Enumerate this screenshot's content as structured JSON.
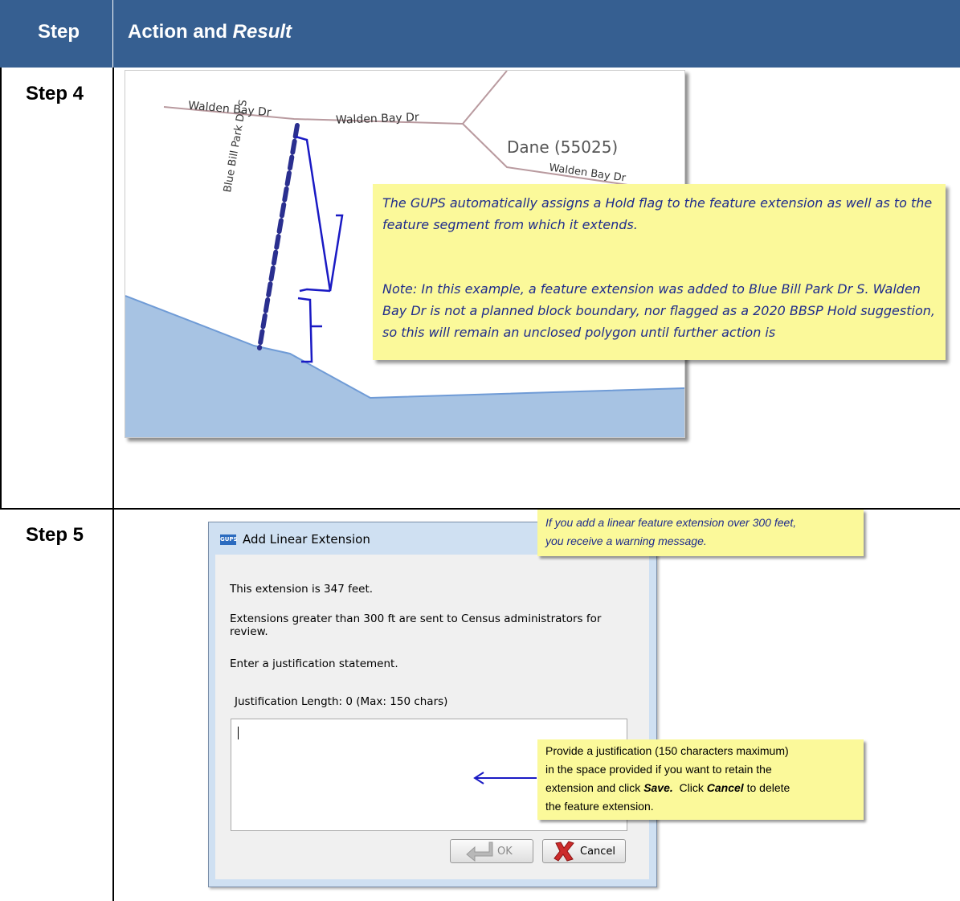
{
  "table": {
    "header": {
      "step": "Step",
      "action": "Action and ",
      "action_italic": "Result"
    },
    "rows": [
      {
        "label": "Step 4"
      },
      {
        "label": "Step 5"
      }
    ]
  },
  "map": {
    "labels": {
      "road_left": "Walden Bay Dr",
      "road_mid": "Walden Bay Dr",
      "road_right": "Walden Bay Dr",
      "county": "Dane (55025)",
      "vertical_road": "Blue Bill Park Dr S"
    },
    "colors": {
      "water": "#a7c3e3",
      "road": "#b99a9f",
      "extension": "#2a2f8f",
      "bracket": "#1a1ac4"
    },
    "callout": {
      "para1": "The GUPS automatically assigns a Hold flag to the feature extension as well as to the feature segment from which it extends.",
      "para2": "Note: In this example, a feature extension was added to Blue Bill Park Dr S. Walden Bay Dr is not a planned block boundary, nor flagged as a 2020 BBSP Hold suggestion, so this will remain an unclosed polygon until further action is"
    }
  },
  "dialog": {
    "icon_text": "GUPS",
    "title": "Add Linear Extension",
    "line1": "This extension is 347 feet.",
    "line2a": "Extensions greater than 300 ft are sent to Census administrators for",
    "line2b": "review.",
    "line3": "Enter a justification statement.",
    "length_label": "Justification Length: 0 (Max: 150 chars)",
    "justification_value": "",
    "ok_label": "OK",
    "cancel_label": "Cancel"
  },
  "callouts": {
    "top_line1": "If you add a linear feature extension over 300 feet,",
    "top_line2": "you receive a warning message.",
    "bottom_line1": "Provide a justification (150 characters maximum)",
    "bottom_line2": "in the space provided if you want to retain the",
    "bottom_line3a": "extension and click ",
    "bottom_save": "Save.",
    "bottom_line3b": "  Click ",
    "bottom_cancel": "Cancel",
    "bottom_line3c": " to delete",
    "bottom_line4": "the feature extension."
  }
}
